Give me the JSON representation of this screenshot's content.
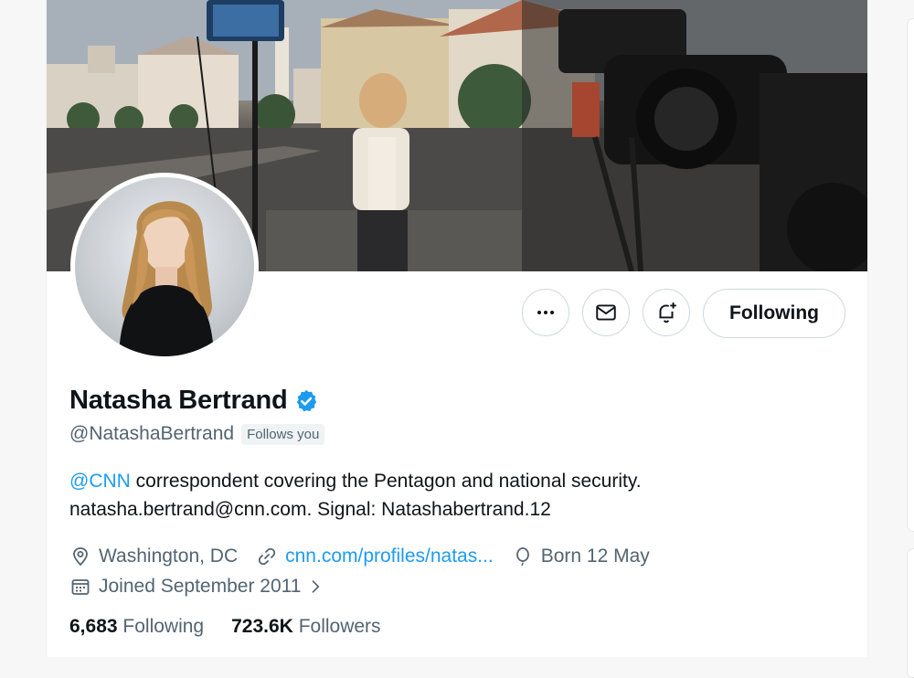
{
  "profile": {
    "name": "Natasha Bertrand",
    "handle": "@NatashaBertrand",
    "follows_you": "Follows you",
    "bio_mention": "@CNN",
    "bio_line1_rest": " correspondent covering the Pentagon and national security.",
    "bio_line2": "natasha.bertrand@cnn.com. Signal: Natashabertrand.12",
    "location": "Washington, DC",
    "website": "cnn.com/profiles/natas...",
    "birthday": "Born 12 May",
    "joined": "Joined September 2011",
    "following_count": "6,683",
    "following_label": "Following",
    "followers_count": "723.6K",
    "followers_label": "Followers"
  },
  "actions": {
    "follow_label": "Following",
    "more_icon": "more-icon",
    "message_icon": "envelope-icon",
    "notify_icon": "bell-plus-icon"
  },
  "colors": {
    "accent": "#1d9bf0",
    "text": "#0f1419",
    "secondary": "#536471"
  }
}
